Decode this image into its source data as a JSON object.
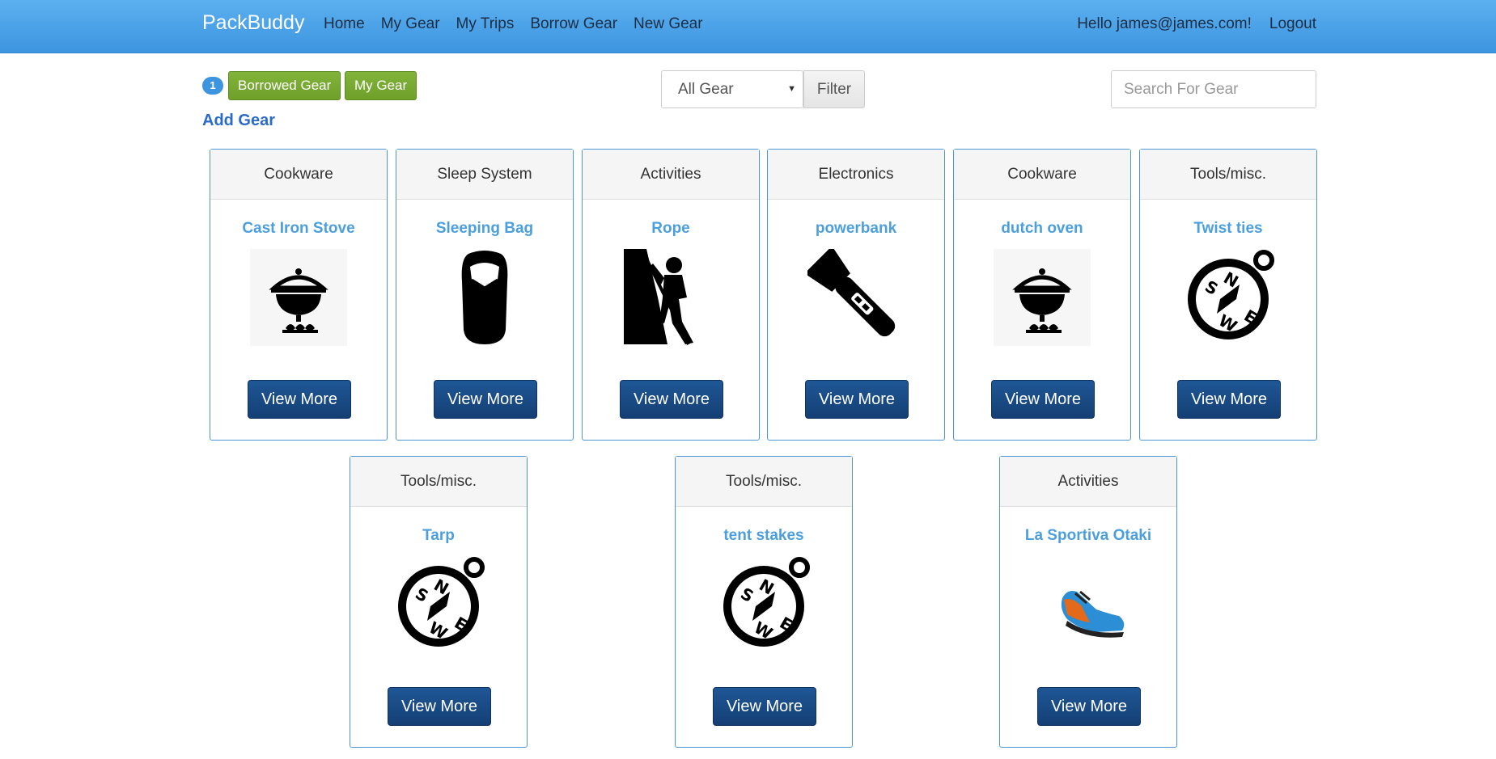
{
  "navbar": {
    "brand": "PackBuddy",
    "links": [
      "Home",
      "My Gear",
      "My Trips",
      "Borrow Gear",
      "New Gear"
    ],
    "greeting": "Hello james@james.com!",
    "logout": "Logout"
  },
  "toolbar": {
    "badge_count": "1",
    "borrowed_label": "Borrowed Gear",
    "mygear_label": "My Gear",
    "add_gear": "Add Gear",
    "category_selected": "All Gear",
    "filter_label": "Filter",
    "search_placeholder": "Search For Gear"
  },
  "cards": [
    {
      "category": "Cookware",
      "title": "Cast Iron Stove",
      "icon": "pot-stove-icon",
      "button": "View More"
    },
    {
      "category": "Sleep System",
      "title": "Sleeping Bag",
      "icon": "sleeping-bag-icon",
      "button": "View More"
    },
    {
      "category": "Activities",
      "title": "Rope",
      "icon": "climber-icon",
      "button": "View More"
    },
    {
      "category": "Electronics",
      "title": "powerbank",
      "icon": "flashlight-icon",
      "button": "View More"
    },
    {
      "category": "Cookware",
      "title": "dutch oven",
      "icon": "pot-stove-icon",
      "button": "View More"
    },
    {
      "category": "Tools/misc.",
      "title": "Twist ties",
      "icon": "compass-icon",
      "button": "View More"
    },
    {
      "category": "Tools/misc.",
      "title": "Tarp",
      "icon": "compass-icon",
      "button": "View More"
    },
    {
      "category": "Tools/misc.",
      "title": "tent stakes",
      "icon": "compass-icon",
      "button": "View More"
    },
    {
      "category": "Activities",
      "title": "La Sportiva Otaki",
      "icon": "climbing-shoe-icon",
      "button": "View More"
    }
  ]
}
